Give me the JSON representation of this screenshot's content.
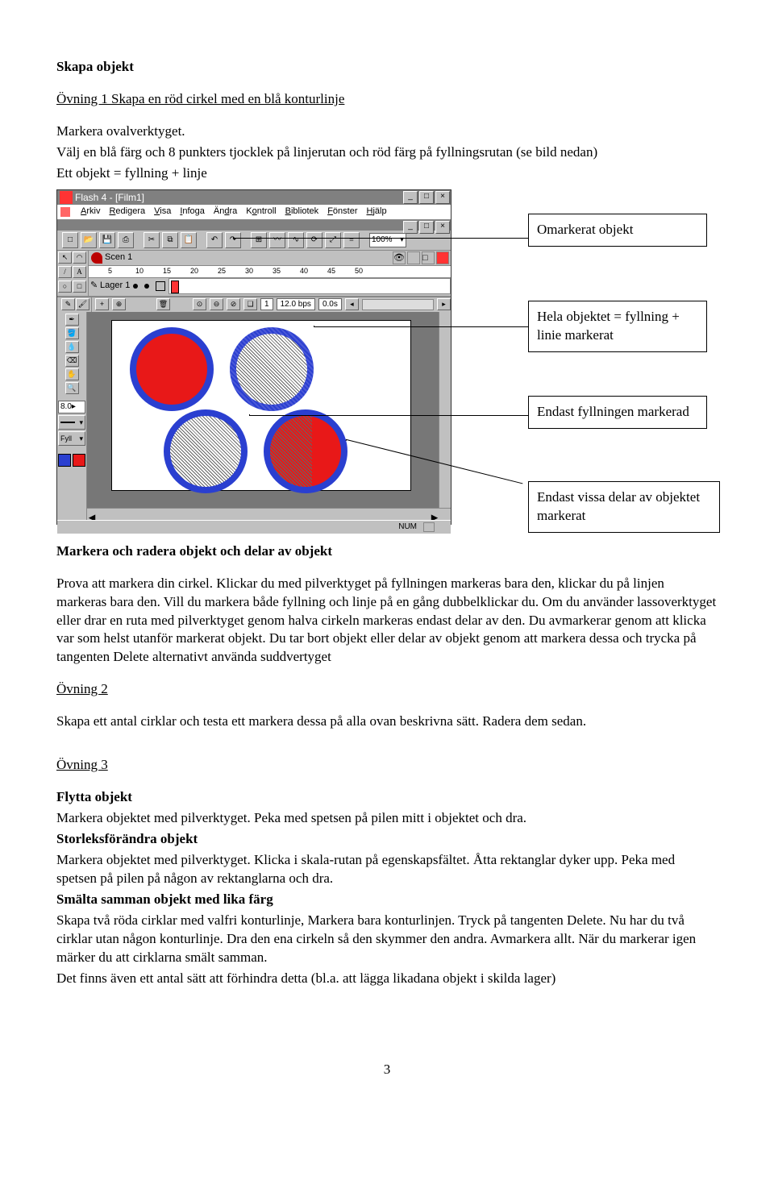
{
  "heading1": "Skapa objekt",
  "ex1_link": "Övning 1 Skapa en röd cirkel med en blå konturlinje",
  "p1": "Markera ovalverktyget.",
  "p2_a": "Välj en blå färg och 8 punkters tjocklek på linjerutan och röd färg på fyllningsrutan (se bild nedan)",
  "p2_b": "Ett objekt = fyllning + linje",
  "screenshot": {
    "title": "Flash 4 - [Film1]",
    "menus": [
      "Arkiv",
      "Redigera",
      "Visa",
      "Infoga",
      "Ändra",
      "Kontroll",
      "Bibliotek",
      "Fönster",
      "Hjälp"
    ],
    "zoom": "100%",
    "scene": "Scen 1",
    "ruler": [
      "5",
      "10",
      "15",
      "20",
      "25",
      "30",
      "35",
      "40",
      "45",
      "50"
    ],
    "layer": "Lager 1",
    "frame": "1",
    "fps": "12.0 bps",
    "time": "0.0s",
    "leftnum": "8.0",
    "leftlab": "Fyll",
    "status": "NUM"
  },
  "callouts": {
    "c1": "Omarkerat objekt",
    "c2a": "Hela objektet = fyllning +",
    "c2b": "linie markerat",
    "c3": "Endast fyllningen markerad",
    "c4a": "Endast vissa delar av objektet",
    "c4b": "markerat"
  },
  "h2": "Markera och radera objekt och delar av objekt",
  "para2": "Prova att markera din cirkel. Klickar du med pilverktyget på fyllningen markeras bara den, klickar du på linjen markeras bara den. Vill du markera både fyllning och linje på en gång dubbelklickar du. Om du använder lassoverktyget eller drar en ruta med pilverktyget genom halva cirkeln markeras endast delar av den. Du avmarkerar genom att klicka var som helst utanför markerat objekt. Du tar bort objekt eller delar av objekt genom att markera dessa och trycka på tangenten Delete alternativt använda suddvertyget",
  "ex2_link": "Övning 2",
  "para3": "Skapa ett antal cirklar och testa ett markera dessa på alla ovan beskrivna sätt. Radera dem sedan.",
  "ex3_link": "Övning 3",
  "h3a": "Flytta objekt",
  "p3a": "Markera objektet med pilverktyget. Peka med spetsen på pilen mitt i objektet och dra.",
  "h3b": "Storleksförändra objekt",
  "p3b": " Markera objektet med pilverktyget. Klicka i skala-rutan på egenskapsfältet. Åtta rektanglar dyker upp.  Peka med spetsen på pilen på någon av rektanglarna och dra.",
  "h3c": "Smälta samman objekt med lika färg",
  "p3c": "Skapa två röda cirklar med valfri konturlinje, Markera bara konturlinjen. Tryck på tangenten Delete. Nu har du två cirklar utan någon konturlinje. Dra den ena cirkeln så den skymmer den andra. Avmarkera allt. När du markerar igen märker du att cirklarna smält samman.",
  "p3d": "Det finns även ett antal sätt att förhindra detta (bl.a. att lägga likadana objekt i skilda lager)",
  "pagenum": "3"
}
